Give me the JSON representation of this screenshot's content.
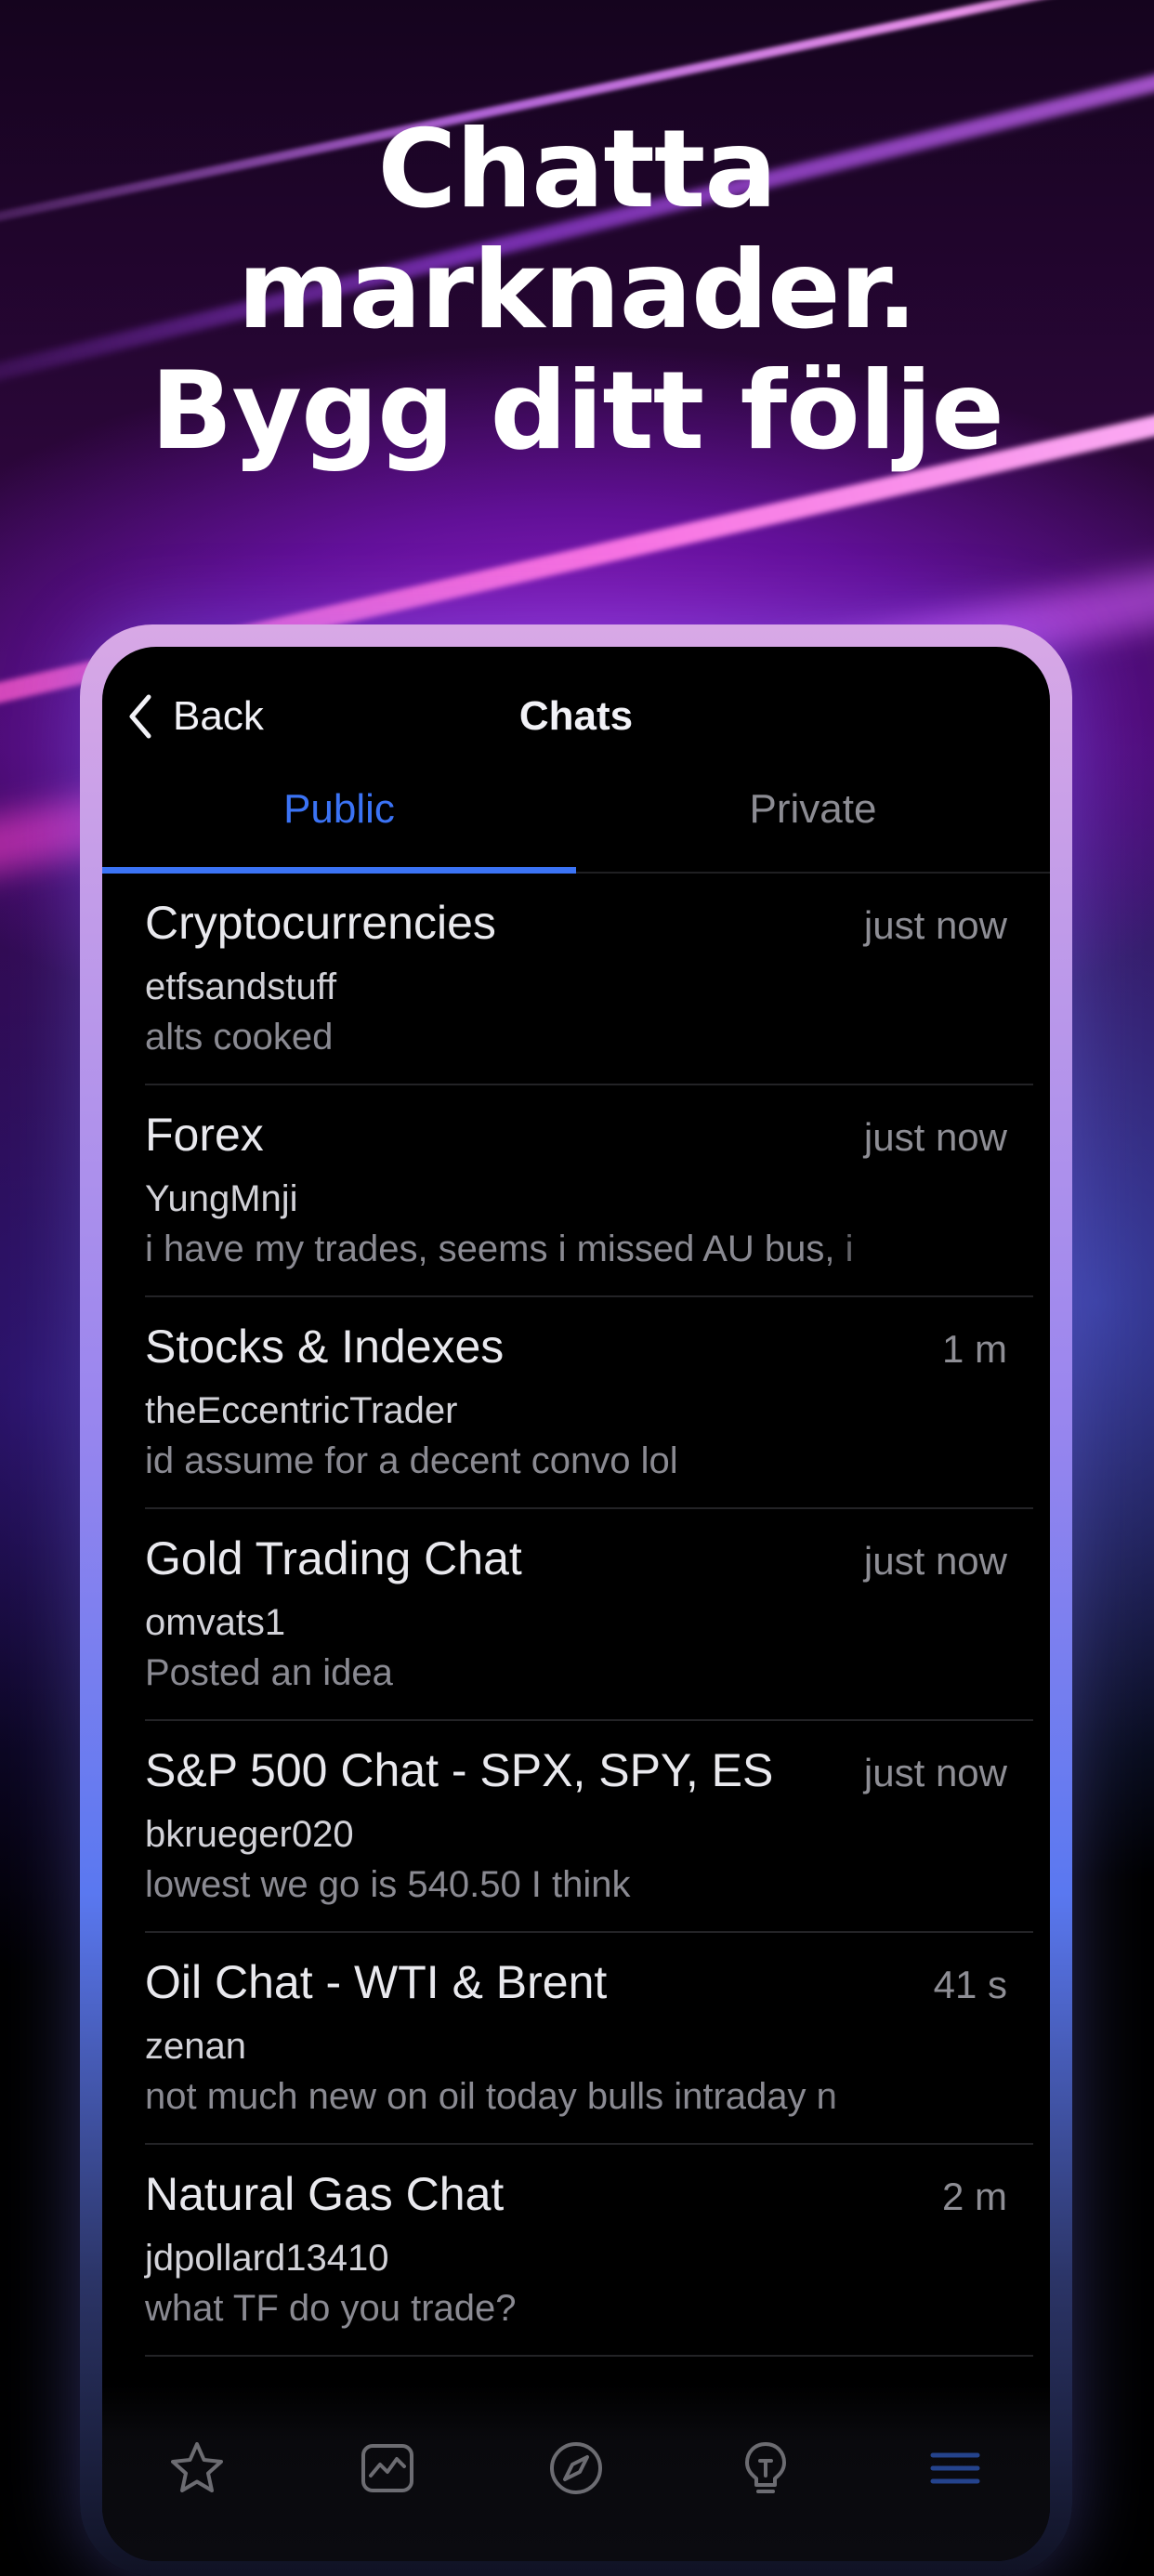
{
  "headline": [
    "Chatta",
    "marknader.",
    "Bygg ditt följe"
  ],
  "nav": {
    "back_label": "Back",
    "title": "Chats"
  },
  "tabs": [
    {
      "label": "Public",
      "active": true
    },
    {
      "label": "Private",
      "active": false
    }
  ],
  "chats": [
    {
      "title": "Cryptocurrencies",
      "time": "just now",
      "user": "etfsandstuff",
      "message": "alts cooked"
    },
    {
      "title": "Forex",
      "time": "just now",
      "user": "YungMnji",
      "message": "i have my trades, seems i missed AU bus, i"
    },
    {
      "title": "Stocks & Indexes",
      "time": "1 m",
      "user": "theEccentricTrader",
      "message": "id assume for a decent convo lol"
    },
    {
      "title": "Gold Trading Chat",
      "time": "just now",
      "user": "omvats1",
      "message": "Posted an idea"
    },
    {
      "title": "S&P 500 Chat - SPX, SPY, ES",
      "time": "just now",
      "user": "bkrueger020",
      "message": "lowest we go is 540.50 I think"
    },
    {
      "title": "Oil Chat - WTI & Brent",
      "time": "41 s",
      "user": "zenan",
      "message": "not much new on oil today bulls intraday n"
    },
    {
      "title": "Natural Gas Chat",
      "time": "2 m",
      "user": "jdpollard13410",
      "message": " what TF do you trade?"
    }
  ],
  "tabbar": [
    "star-icon",
    "chart-icon",
    "compass-icon",
    "lightbulb-icon",
    "menu-icon"
  ],
  "colors": {
    "accent": "#3b73f5",
    "background": "#000000"
  }
}
